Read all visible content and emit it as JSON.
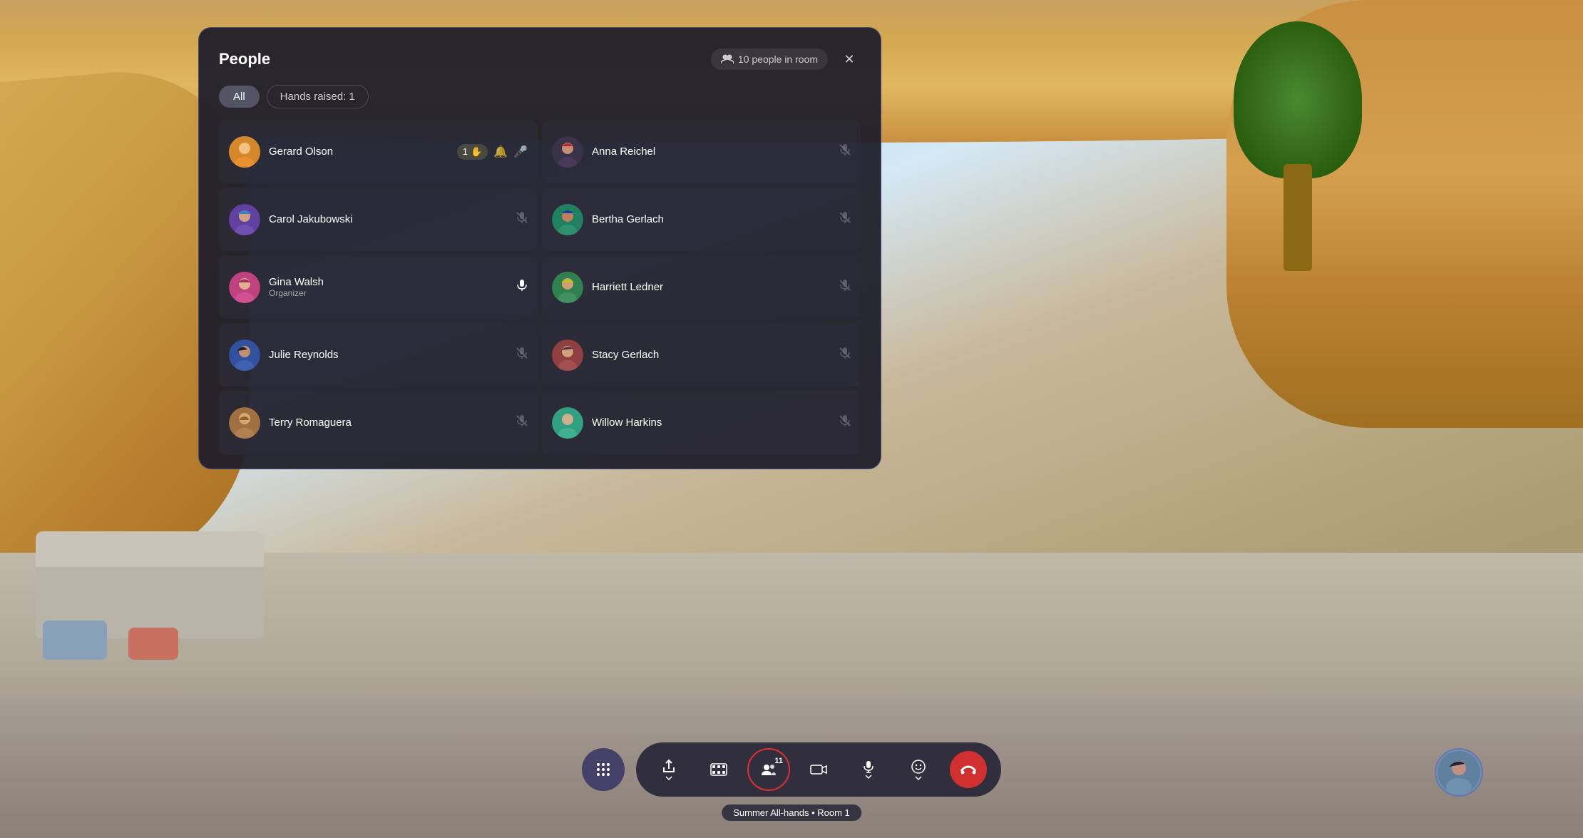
{
  "background": {
    "description": "3D virtual meeting room background"
  },
  "panel": {
    "title": "People",
    "close_label": "×",
    "people_count": "10 people in room",
    "tabs": {
      "all_label": "All",
      "hands_label": "Hands raised: 1"
    },
    "people": [
      {
        "id": "gerard-olson",
        "name": "Gerard Olson",
        "role": "",
        "avatar_color": "orange",
        "hand_count": "1",
        "has_hand": true,
        "has_bell": true,
        "mic": "active",
        "muted": false,
        "side": "left"
      },
      {
        "id": "anna-reichel",
        "name": "Anna Reichel",
        "role": "",
        "avatar_color": "dark",
        "has_hand": false,
        "mic": "muted",
        "muted": true,
        "side": "right"
      },
      {
        "id": "carol-jakubowski",
        "name": "Carol Jakubowski",
        "role": "",
        "avatar_color": "purple",
        "has_hand": false,
        "mic": "muted",
        "muted": true,
        "side": "left"
      },
      {
        "id": "bertha-gerlach",
        "name": "Bertha Gerlach",
        "role": "",
        "avatar_color": "teal",
        "has_hand": false,
        "mic": "muted",
        "muted": true,
        "side": "right"
      },
      {
        "id": "gina-walsh",
        "name": "Gina Walsh",
        "role": "Organizer",
        "avatar_color": "pink",
        "has_hand": false,
        "mic": "active",
        "muted": false,
        "side": "left"
      },
      {
        "id": "harriett-ledner",
        "name": "Harriett Ledner",
        "role": "",
        "avatar_color": "green",
        "has_hand": false,
        "mic": "muted",
        "muted": true,
        "side": "right"
      },
      {
        "id": "julie-reynolds",
        "name": "Julie Reynolds",
        "role": "",
        "avatar_color": "blue",
        "has_hand": false,
        "mic": "muted",
        "muted": true,
        "side": "left"
      },
      {
        "id": "stacy-gerlach",
        "name": "Stacy Gerlach",
        "role": "",
        "avatar_color": "red",
        "has_hand": false,
        "mic": "muted",
        "muted": true,
        "side": "right"
      },
      {
        "id": "terry-romaguera",
        "name": "Terry Romaguera",
        "role": "",
        "avatar_color": "brown",
        "has_hand": false,
        "mic": "muted",
        "muted": true,
        "side": "left"
      },
      {
        "id": "willow-harkins",
        "name": "Willow Harkins",
        "role": "",
        "avatar_color": "light",
        "has_hand": false,
        "mic": "muted",
        "muted": true,
        "side": "right"
      }
    ]
  },
  "toolbar": {
    "grid_btn_label": "⠿",
    "share_label": "⬆",
    "filmstrip_label": "▭",
    "people_label": "👤",
    "people_count": "11",
    "camera_label": "📷",
    "mic_label": "🎤",
    "emoji_label": "😊",
    "end_label": "✕",
    "meeting_name": "Summer All-hands • Room 1"
  },
  "avatars": {
    "gerard_emoji": "🧑",
    "anna_emoji": "👩",
    "carol_emoji": "👩",
    "bertha_emoji": "👩",
    "gina_emoji": "👩",
    "harriett_emoji": "👩",
    "julie_emoji": "👩",
    "stacy_emoji": "👩",
    "terry_emoji": "🧔",
    "willow_emoji": "👩",
    "local_emoji": "👩"
  }
}
